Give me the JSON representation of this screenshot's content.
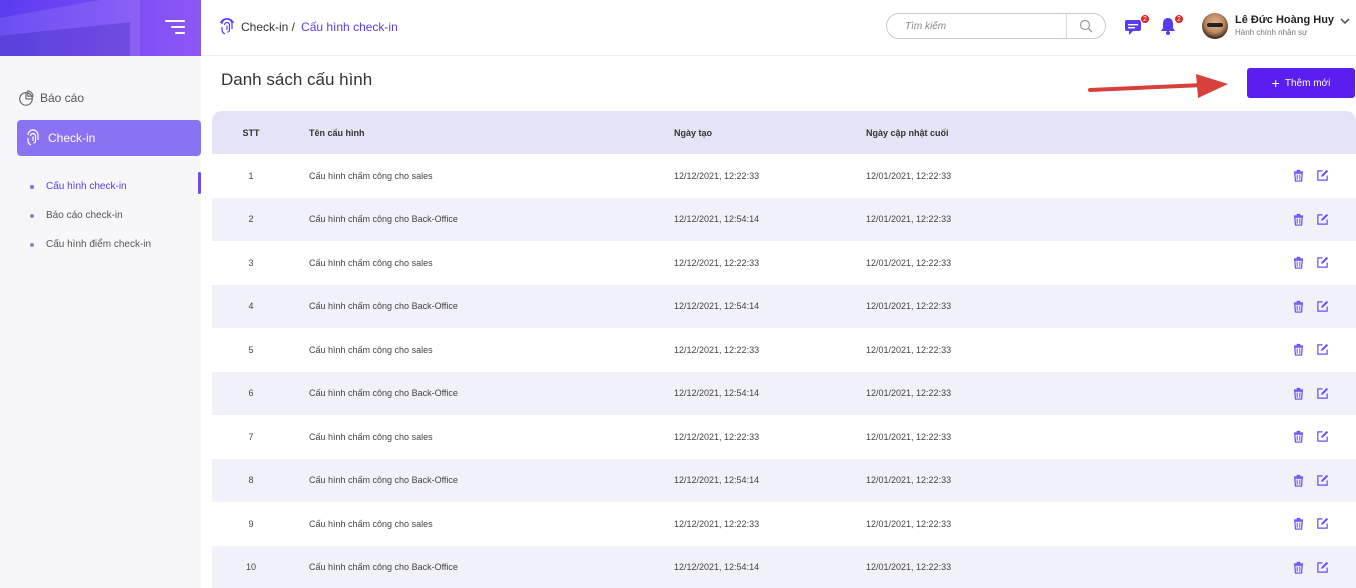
{
  "sidebar": {
    "report_label": "Báo cáo",
    "checkin_label": "Check-in",
    "submenu": [
      {
        "label": "Cấu hình check-in",
        "active": true
      },
      {
        "label": "Báo cáo check-in",
        "active": false
      },
      {
        "label": "Cấu hình điểm check-in",
        "active": false
      }
    ]
  },
  "header": {
    "breadcrumb_root": "Check-in /",
    "breadcrumb_current": "Cấu hình check-in",
    "search_placeholder": "Tìm kiếm",
    "messages_badge": "2",
    "notifications_badge": "2",
    "user_name": "Lê Đức Hoàng Huy",
    "user_role": "Hành chính nhân sự"
  },
  "main": {
    "title": "Danh sách cấu hình",
    "add_label": "Thêm mới",
    "columns": {
      "stt": "STT",
      "name": "Tên cấu hình",
      "created": "Ngày tạo",
      "updated": "Ngày cập nhật cuối"
    },
    "rows": [
      {
        "stt": "1",
        "name": "Cấu hình chấm công cho sales",
        "created": "12/12/2021, 12:22:33",
        "updated": "12/01/2021, 12:22:33"
      },
      {
        "stt": "2",
        "name": "Cấu hình chấm công cho Back-Office",
        "created": "12/12/2021, 12:54:14",
        "updated": "12/01/2021, 12:22:33"
      },
      {
        "stt": "3",
        "name": "Cấu hình chấm công cho sales",
        "created": "12/12/2021, 12:22:33",
        "updated": "12/01/2021, 12:22:33"
      },
      {
        "stt": "4",
        "name": "Cấu hình chấm công cho Back-Office",
        "created": "12/12/2021, 12:54:14",
        "updated": "12/01/2021, 12:22:33"
      },
      {
        "stt": "5",
        "name": "Cấu hình chấm công cho sales",
        "created": "12/12/2021, 12:22:33",
        "updated": "12/01/2021, 12:22:33"
      },
      {
        "stt": "6",
        "name": "Cấu hình chấm công cho Back-Office",
        "created": "12/12/2021, 12:54:14",
        "updated": "12/01/2021, 12:22:33"
      },
      {
        "stt": "7",
        "name": "Cấu hình chấm công cho sales",
        "created": "12/12/2021, 12:22:33",
        "updated": "12/01/2021, 12:22:33"
      },
      {
        "stt": "8",
        "name": "Cấu hình chấm công cho Back-Office",
        "created": "12/12/2021, 12:54:14",
        "updated": "12/01/2021, 12:22:33"
      },
      {
        "stt": "9",
        "name": "Cấu hình chấm công cho sales",
        "created": "12/12/2021, 12:22:33",
        "updated": "12/01/2021, 12:22:33"
      },
      {
        "stt": "10",
        "name": "Cấu hình chấm công cho Back-Office",
        "created": "12/12/2021, 12:54:14",
        "updated": "12/01/2021, 12:22:33"
      }
    ]
  },
  "colors": {
    "brand": "#5a1ff0",
    "sidebar_active": "#8a73f3",
    "header_row": "#e4e4f6",
    "alt_row": "#f1f1f9",
    "arrow": "#d8403a",
    "badge": "#e02424"
  },
  "icons": {
    "menu": "hamburger-icon",
    "report": "pie-chart-icon",
    "checkin": "fingerprint-icon",
    "search": "search-icon",
    "messages": "chat-icon",
    "notifications": "bell-icon",
    "delete": "trash-icon",
    "edit": "edit-icon"
  }
}
